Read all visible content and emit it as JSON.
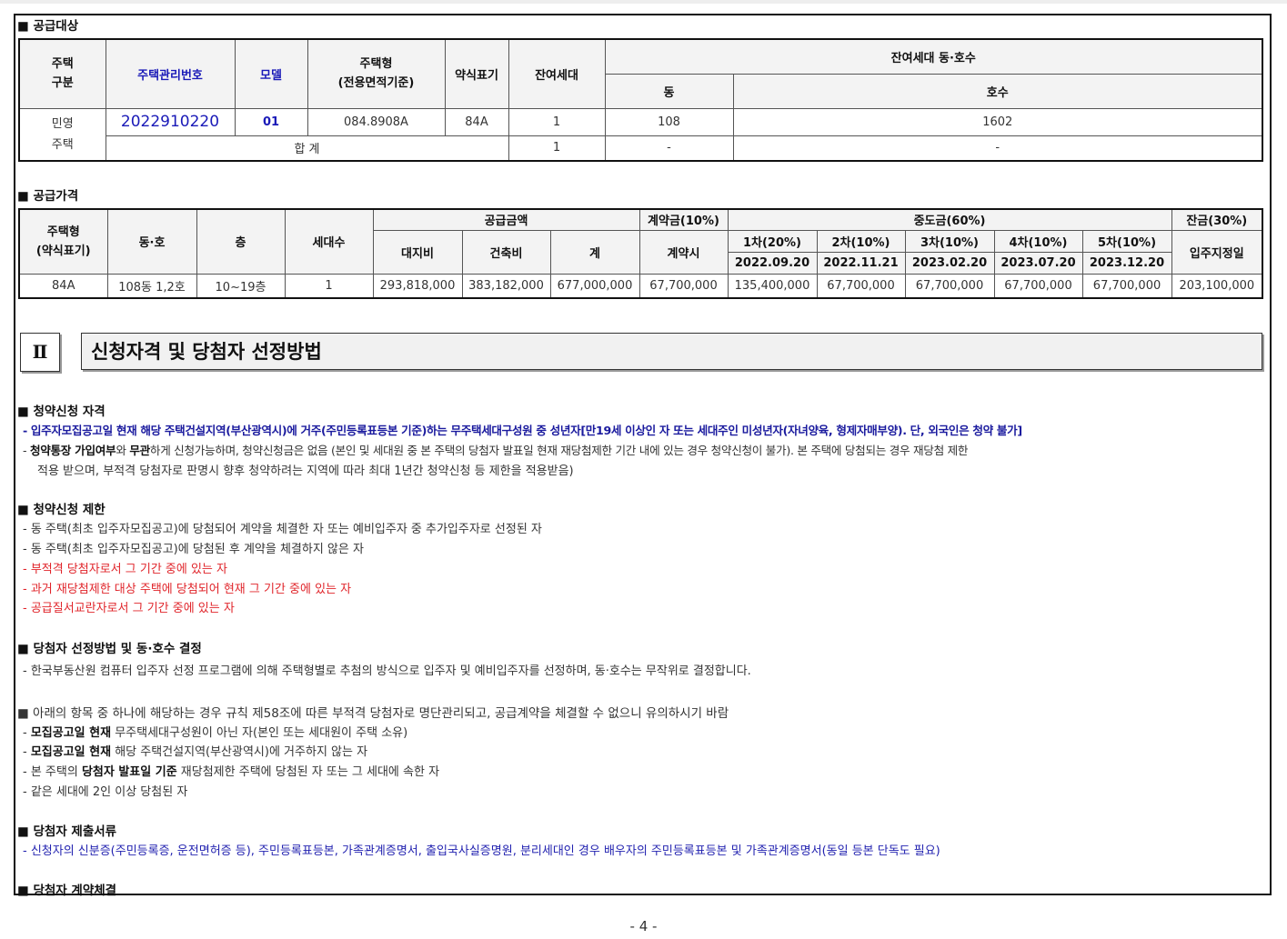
{
  "supply_target": {
    "heading": "■ 공급대상",
    "headers": {
      "house_type": "주택\n구분",
      "mgmt_no": "주택관리번호",
      "model": "모델",
      "unit_type": "주택형\n(전용면적기준)",
      "short": "약식표기",
      "remaining": "잔여세대",
      "remaining_unit": "잔여세대 동·호수",
      "dong": "동",
      "ho": "호수"
    },
    "row": {
      "house_type": "민영\n주택",
      "mgmt_no": "2022910220",
      "model": "01",
      "unit_type": "084.8908A",
      "short": "84A",
      "remaining": "1",
      "dong": "108",
      "ho": "1602"
    },
    "total": {
      "label": "합 계",
      "remaining": "1",
      "dong": "-",
      "ho": "-"
    }
  },
  "supply_price": {
    "heading": "■ 공급가격",
    "headers": {
      "unit_type": "주택형\n(약식표기)",
      "dongho": "동·호",
      "floor": "층",
      "households": "세대수",
      "supply_amount": "공급금액",
      "land": "대지비",
      "building": "건축비",
      "sum": "계",
      "deposit": "계약금(10%)",
      "deposit_when": "계약시",
      "middle": "중도금(60%)",
      "balance": "잔금(30%)",
      "balance_when": "입주지정일",
      "installments": [
        "1차(20%)",
        "2차(10%)",
        "3차(10%)",
        "4차(10%)",
        "5차(10%)"
      ],
      "dates": [
        "2022.09.20",
        "2022.11.21",
        "2023.02.20",
        "2023.07.20",
        "2023.12.20"
      ]
    },
    "row": {
      "unit_type": "84A",
      "dongho": "108동 1,2호",
      "floor": "10~19층",
      "households": "1",
      "land": "293,818,000",
      "building": "383,182,000",
      "sum": "677,000,000",
      "deposit": "67,700,000",
      "installments": [
        "135,400,000",
        "67,700,000",
        "67,700,000",
        "67,700,000",
        "67,700,000"
      ],
      "balance": "203,100,000"
    }
  },
  "chapter": {
    "number": "Ⅱ",
    "title": "신청자격 및 당첨자 선정방법"
  },
  "qualification": {
    "heading": "■ 청약신청 자격",
    "line1": "- 입주자모집공고일 현재 해당 주택건설지역(부산광역시)에 거주(주민등록표등본 기준)하는 무주택세대구성원 중 성년자[만19세 이상인 자 또는 세대주인 미성년자(자녀양육, 형제자매부양). 단, 외국인은 청약 불가]",
    "line2_a": "- ",
    "line2_b": "청약통장 가입여부",
    "line2_c": "와 ",
    "line2_d": "무관",
    "line2_e": "하게 신청가능하며, 청약신청금은 없음 (본인 및 세대원 중 본 주택의 당첨자 발표일 현재 재당첨제한 기간 내에 있는 경우 청약신청이 불가). 본 주택에 당첨되는 경우 재당첨 제한",
    "line3": "적용 받으며, 부적격 당첨자로 판명시 향후 청약하려는 지역에 따라 최대 1년간 청약신청 등 제한을 적용받음)"
  },
  "restriction": {
    "heading": "■ 청약신청 제한",
    "lines": [
      "- 동 주택(최초 입주자모집공고)에 당첨되어 계약을 체결한 자 또는 예비입주자 중 추가입주자로 선정된 자",
      "- 동 주택(최초 입주자모집공고)에 당첨된 후 계약을 체결하지 않은 자"
    ],
    "red_lines": [
      "- 부적격 당첨자로서 그 기간 중에 있는 자",
      "- 과거 재당첨제한 대상 주택에 당첨되어 현재 그 기간 중에 있는 자",
      "- 공급질서교란자로서 그 기간 중에 있는 자"
    ]
  },
  "selection": {
    "heading": "■ 당첨자 선정방법 및 동·호수 결정",
    "line": "- 한국부동산원 컴퓨터 입주자 선정 프로그램에 의해 주택형별로 추첨의 방식으로 입주자 및 예비입주자를 선정하며, 동·호수는 무작위로 결정합니다."
  },
  "warning": {
    "heading": "■ 아래의 항목 중 하나에 해당하는 경우 규칙 제58조에 따른 부적격 당첨자로 명단관리되고, 공급계약을 체결할 수 없으니 유의하시기 바람",
    "l1_a": "- ",
    "l1_b": "모집공고일 현재",
    "l1_c": " 무주택세대구성원이 아닌 자(본인 또는 세대원이 주택 소유)",
    "l2_a": "- ",
    "l2_b": "모집공고일 현재",
    "l2_c": " 해당 주택건설지역(부산광역시)에 거주하지 않는 자",
    "l3_a": "- 본 주택의 ",
    "l3_b": "당첨자 발표일 기준",
    "l3_c": " 재당첨제한 주택에 당첨된 자 또는 그 세대에 속한 자",
    "l4": "- 같은 세대에 2인 이상 당첨된 자"
  },
  "documents": {
    "heading": "■ 당첨자 제출서류",
    "line": "- 신청자의 신분증(주민등록증, 운전면허증 등), 주민등록표등본, 가족관계증명서, 출입국사실증명원, 분리세대인 경우 배우자의 주민등록표등본 및 가족관계증명서(동일 등본 단독도 필요)"
  },
  "contract": {
    "heading": "■ 당첨자 계약체결"
  },
  "page_number": "- 4 -"
}
